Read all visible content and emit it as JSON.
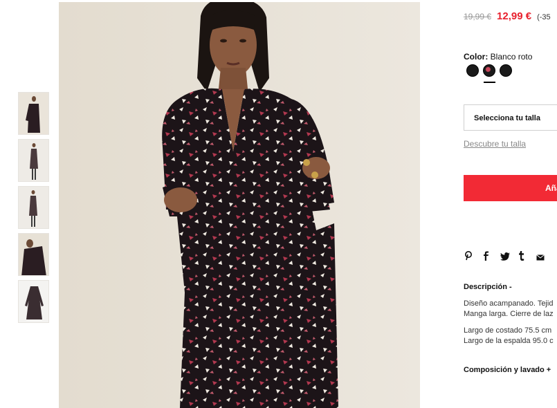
{
  "gallery": {
    "thumbnail_count": 5
  },
  "product": {
    "old_price": "19,99 €",
    "new_price": "12,99 €",
    "discount": "(-35",
    "color_label": "Color:",
    "color_value": "Blanco roto",
    "size_select_label": "Selecciona tu talla",
    "size_guide_link": "Descubre tu talla",
    "add_button_label": "Aña"
  },
  "share_icons": [
    "pinterest-icon",
    "facebook-icon",
    "twitter-icon",
    "tumblr-icon",
    "email-icon"
  ],
  "description": {
    "title": "Descripción -",
    "lines_1": [
      "Diseño acampanado. Tejid",
      "Manga larga. Cierre de laz"
    ],
    "lines_2": [
      "Largo de costado 75.5 cm",
      "Largo de la espalda 95.0 c"
    ]
  },
  "composition": {
    "title": "Composición y lavado +"
  },
  "colors": {
    "accent": "#f22a35",
    "sale_price": "#e8202d"
  }
}
